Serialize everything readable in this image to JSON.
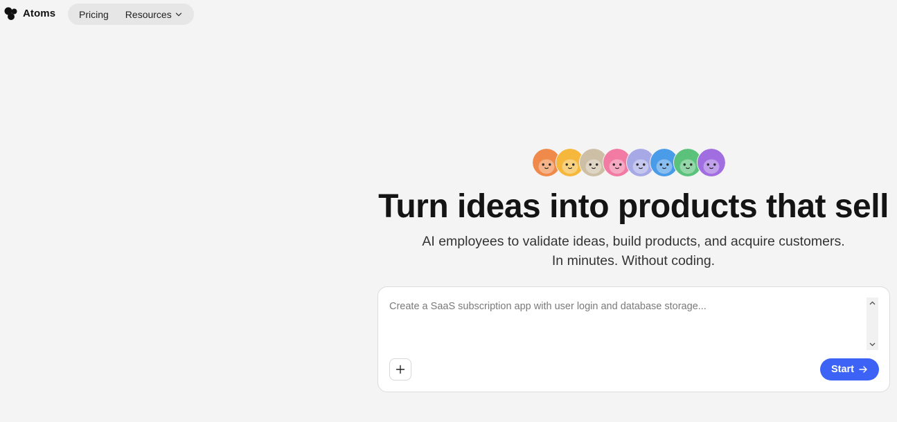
{
  "brand": {
    "name": "Atoms"
  },
  "nav": {
    "items": [
      {
        "label": "Pricing"
      },
      {
        "label": "Resources",
        "icon": "chevron-down-icon"
      }
    ]
  },
  "hero": {
    "avatars": [
      {
        "name": "orange-avatar",
        "color": "#f08a4b"
      },
      {
        "name": "yellow-avatar",
        "color": "#f5b83d"
      },
      {
        "name": "beige-avatar",
        "color": "#cdbfa6"
      },
      {
        "name": "pink-avatar",
        "color": "#f27ba3"
      },
      {
        "name": "lavender-avatar",
        "color": "#a6a9e6"
      },
      {
        "name": "blue-avatar",
        "color": "#4a9be8"
      },
      {
        "name": "green-avatar",
        "color": "#5ac27a"
      },
      {
        "name": "purple-avatar",
        "color": "#a06ee0"
      }
    ],
    "title": "Turn ideas into products that sell",
    "subtitle_line1": "AI employees to validate ideas, build products, and acquire customers.",
    "subtitle_line2": "In minutes. Without coding."
  },
  "prompt": {
    "placeholder": "Create a SaaS subscription app with user login and database storage...",
    "value": "",
    "attach_icon": "plus-icon",
    "start_label": "Start",
    "start_icon": "arrow-right-icon",
    "accent": "#3d63f6"
  }
}
